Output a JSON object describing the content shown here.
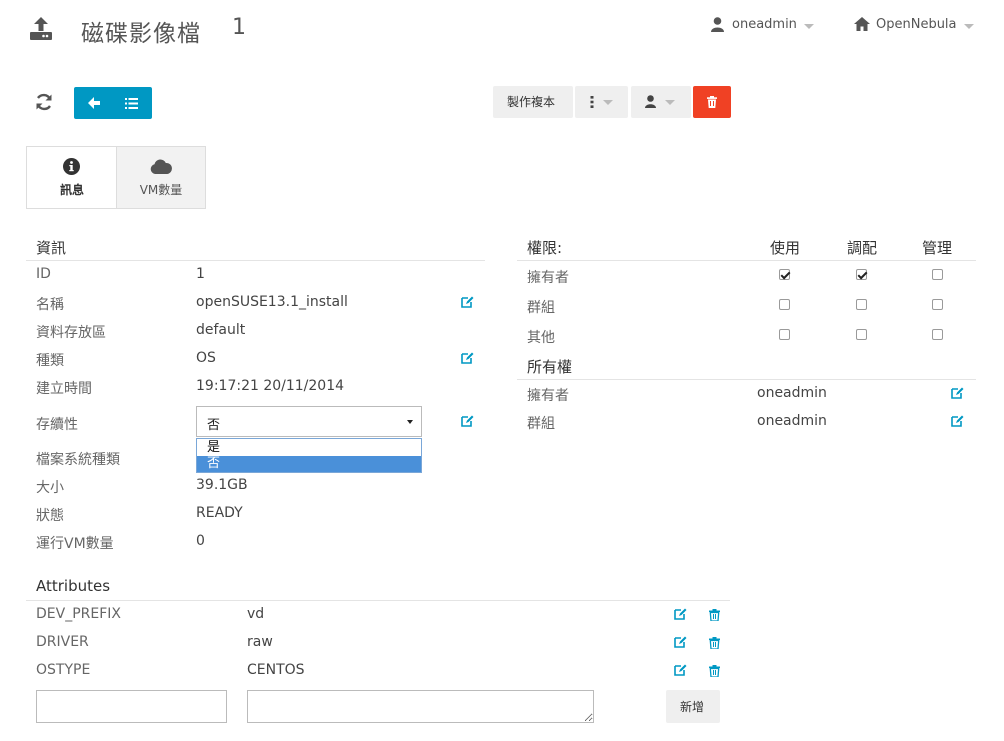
{
  "header": {
    "title": "磁碟影像檔",
    "id": "1",
    "user": "oneadmin",
    "zone": "OpenNebula"
  },
  "toolbar": {
    "clone_label": "製作複本"
  },
  "tabs": [
    {
      "label": "訊息"
    },
    {
      "label": "VM數量"
    }
  ],
  "info": {
    "section_title": "資訊",
    "rows": [
      {
        "label": "ID",
        "value": "1"
      },
      {
        "label": "名稱",
        "value": "openSUSE13.1_install"
      },
      {
        "label": "資料存放區",
        "value": "default"
      },
      {
        "label": "種類",
        "value": "OS"
      },
      {
        "label": "建立時間",
        "value": "19:17:21 20/11/2014"
      },
      {
        "label": "存續性",
        "value": "否"
      },
      {
        "label": "檔案系統種類",
        "value": ""
      },
      {
        "label": "大小",
        "value": "39.1GB"
      },
      {
        "label": "狀態",
        "value": "READY"
      },
      {
        "label": "運行VM數量",
        "value": "0"
      }
    ],
    "persistent_options": [
      "是",
      "否"
    ]
  },
  "permissions": {
    "title": "權限:",
    "col_use": "使用",
    "col_manage": "調配",
    "col_admin": "管理",
    "rows": [
      {
        "label": "擁有者",
        "use": true,
        "manage": true,
        "admin": false
      },
      {
        "label": "群組",
        "use": false,
        "manage": false,
        "admin": false
      },
      {
        "label": "其他",
        "use": false,
        "manage": false,
        "admin": false
      }
    ]
  },
  "ownership": {
    "title": "所有權",
    "rows": [
      {
        "label": "擁有者",
        "value": "oneadmin"
      },
      {
        "label": "群組",
        "value": "oneadmin"
      }
    ]
  },
  "attributes": {
    "title": "Attributes",
    "rows": [
      {
        "key": "DEV_PREFIX",
        "value": "vd"
      },
      {
        "key": "DRIVER",
        "value": "raw"
      },
      {
        "key": "OSTYPE",
        "value": "CENTOS"
      }
    ],
    "add_label": "新增"
  },
  "colors": {
    "accent": "#0098c3",
    "danger": "#f04124",
    "selected": "#4a90d9"
  }
}
